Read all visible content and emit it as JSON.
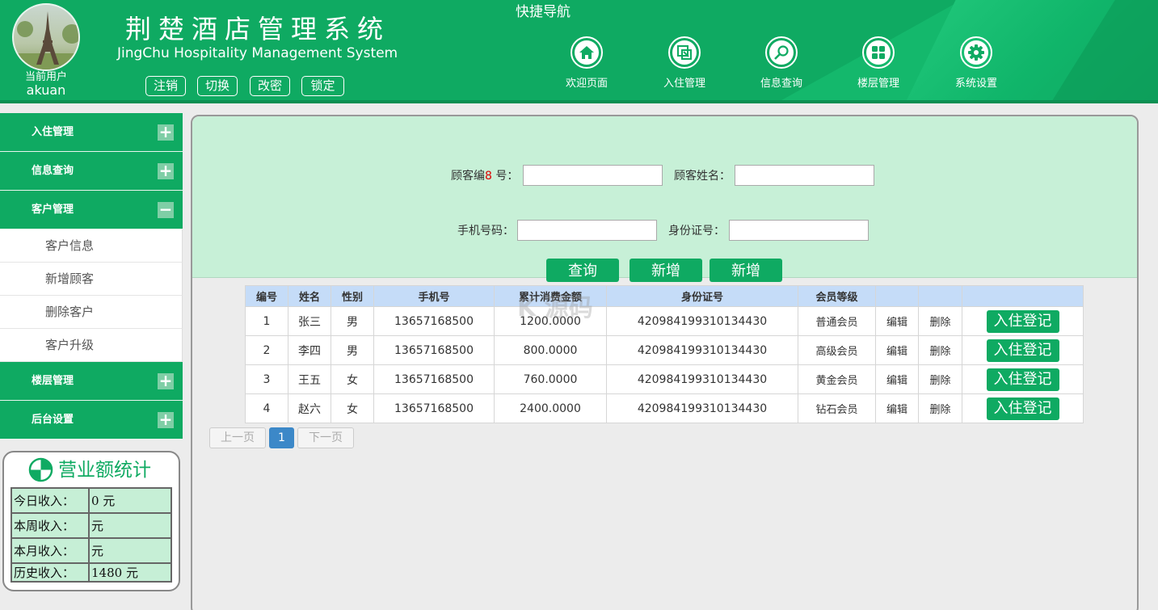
{
  "header": {
    "user_label": "当前用户",
    "user_name": "akuan",
    "title": "荆楚酒店管理系统",
    "subtitle": "JingChu Hospitality Management System",
    "buttons": [
      "注销",
      "切换",
      "改密",
      "锁定"
    ],
    "quick_nav_title": "快捷导航",
    "quick_nav": [
      {
        "label": "欢迎页面",
        "icon": "home-icon"
      },
      {
        "label": "入住管理",
        "icon": "checkin-icon"
      },
      {
        "label": "信息查询",
        "icon": "search-icon"
      },
      {
        "label": "楼层管理",
        "icon": "grid-icon"
      },
      {
        "label": "系统设置",
        "icon": "gear-icon"
      }
    ]
  },
  "sidebar": {
    "sections": [
      {
        "label": "入住管理",
        "state": "+"
      },
      {
        "label": "信息查询",
        "state": "+"
      },
      {
        "label": "客户管理",
        "state": "−"
      },
      {
        "label": "楼层管理",
        "state": "+"
      },
      {
        "label": "后台设置",
        "state": "+"
      }
    ],
    "customer_items": [
      "客户信息",
      "新增顾客",
      "删除客户",
      "客户升级"
    ]
  },
  "stats": {
    "title": "营业额统计",
    "rows": [
      {
        "label": "今日收入：",
        "value": "0 元"
      },
      {
        "label": "本周收入：",
        "value": "元"
      },
      {
        "label": "本月收入：",
        "value": "元"
      },
      {
        "label": "历史收入：",
        "value": "1480 元"
      }
    ]
  },
  "search": {
    "customer_id_label_a": "顾客编",
    "customer_id_label_red": "8",
    "customer_id_label_b": " 号：",
    "customer_name_label": "顾客姓名：",
    "phone_label": "手机号码：",
    "id_card_label": "身份证号：",
    "customer_id_value": "",
    "customer_name_value": "",
    "phone_value": "",
    "id_card_value": "",
    "buttons": [
      "查询",
      "新增",
      "新增"
    ]
  },
  "table": {
    "headers": [
      "编号",
      "姓名",
      "性别",
      "手机号",
      "累计消费金额",
      "身份证号",
      "会员等级",
      "",
      "",
      ""
    ],
    "rows": [
      [
        "1",
        "张三",
        "男",
        "13657168500",
        "1200.0000",
        "420984199310134430",
        "普通会员",
        "编辑",
        "删除",
        "入住登记"
      ],
      [
        "2",
        "李四",
        "男",
        "13657168500",
        "800.0000",
        "420984199310134430",
        "高级会员",
        "编辑",
        "删除",
        "入住登记"
      ],
      [
        "3",
        "王五",
        "女",
        "13657168500",
        "760.0000",
        "420984199310134430",
        "黄金会员",
        "编辑",
        "删除",
        "入住登记"
      ],
      [
        "4",
        "赵六",
        "女",
        "13657168500",
        "2400.0000",
        "420984199310134430",
        "钻石会员",
        "编辑",
        "删除",
        "入住登记"
      ]
    ]
  },
  "pager": {
    "prev": "上一页",
    "current": "1",
    "next": "下一页"
  },
  "watermark": "K 源码",
  "colors": {
    "brand": "#0faa62",
    "panel": "#c7f0d7",
    "table_head": "#c5dcf8",
    "pager_active": "#3c88c8"
  }
}
